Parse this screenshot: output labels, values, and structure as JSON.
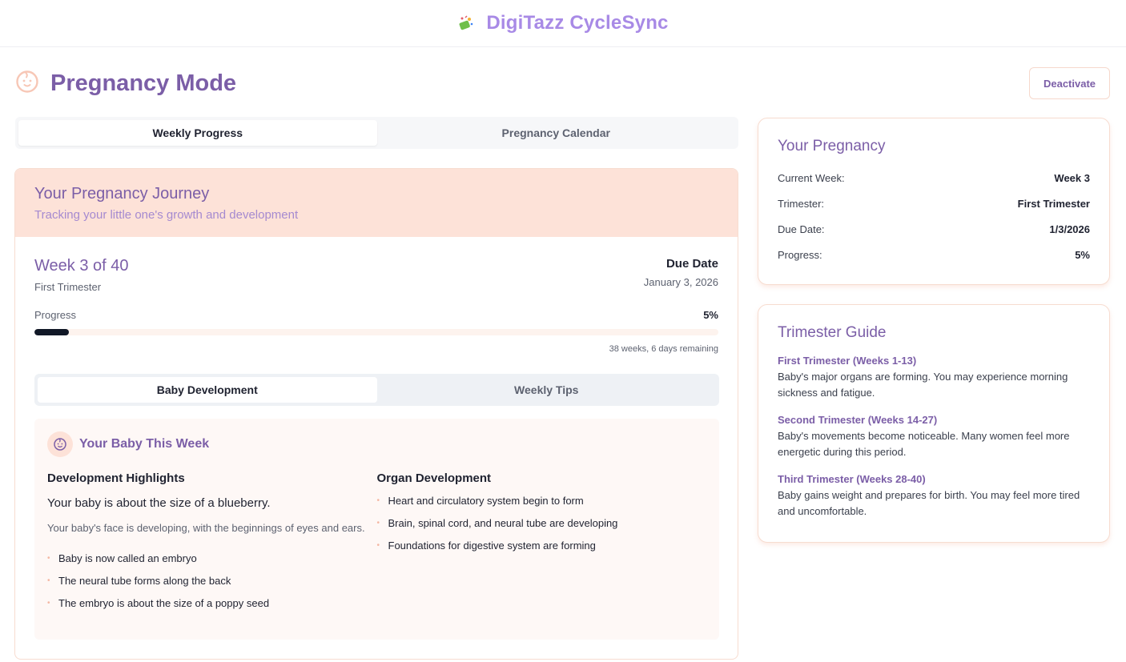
{
  "app": {
    "title": "DigiTazz CycleSync"
  },
  "header": {
    "title": "Pregnancy Mode",
    "deactivate_label": "Deactivate"
  },
  "main_tabs": [
    {
      "label": "Weekly Progress",
      "active": true
    },
    {
      "label": "Pregnancy Calendar",
      "active": false
    }
  ],
  "journey": {
    "title": "Your Pregnancy Journey",
    "subtitle": "Tracking your little one's growth and development",
    "week_title": "Week 3 of 40",
    "trimester": "First Trimester",
    "due_label": "Due Date",
    "due_value": "January 3, 2026",
    "progress_label": "Progress",
    "progress_pct": "5%",
    "progress_value": 0.05,
    "remaining": "38 weeks, 6 days remaining"
  },
  "sub_tabs": [
    {
      "label": "Baby Development",
      "active": true
    },
    {
      "label": "Weekly Tips",
      "active": false
    }
  ],
  "baby": {
    "title": "Your Baby This Week",
    "highlights_head": "Development Highlights",
    "size_line": "Your baby is about the size of a blueberry.",
    "face_line": "Your baby's face is developing, with the beginnings of eyes and ears.",
    "highlights": [
      "Baby is now called an embryo",
      "The neural tube forms along the back",
      "The embryo is about the size of a poppy seed"
    ],
    "organ_head": "Organ Development",
    "organs": [
      "Heart and circulatory system begin to form",
      "Brain, spinal cord, and neural tube are developing",
      "Foundations for digestive system are forming"
    ]
  },
  "summary": {
    "title": "Your Pregnancy",
    "rows": [
      {
        "label": "Current Week:",
        "value": "Week 3"
      },
      {
        "label": "Trimester:",
        "value": "First Trimester"
      },
      {
        "label": "Due Date:",
        "value": "1/3/2026"
      },
      {
        "label": "Progress:",
        "value": "5%"
      }
    ]
  },
  "guide": {
    "title": "Trimester Guide",
    "items": [
      {
        "title": "First Trimester (Weeks 1-13)",
        "desc": "Baby's major organs are forming. You may experience morning sickness and fatigue."
      },
      {
        "title": "Second Trimester (Weeks 14-27)",
        "desc": "Baby's movements become noticeable. Many women feel more energetic during this period."
      },
      {
        "title": "Third Trimester (Weeks 28-40)",
        "desc": "Baby gains weight and prepares for birth. You may feel more tired and uncomfortable."
      }
    ]
  },
  "colors": {
    "accent": "#7b5ea7",
    "brand": "#a88ae6",
    "peach": "#fde2d8",
    "progress": "#111827"
  },
  "icons": {
    "brand": "party-logo-icon",
    "page": "baby-face-icon",
    "baby": "baby-face-icon"
  }
}
